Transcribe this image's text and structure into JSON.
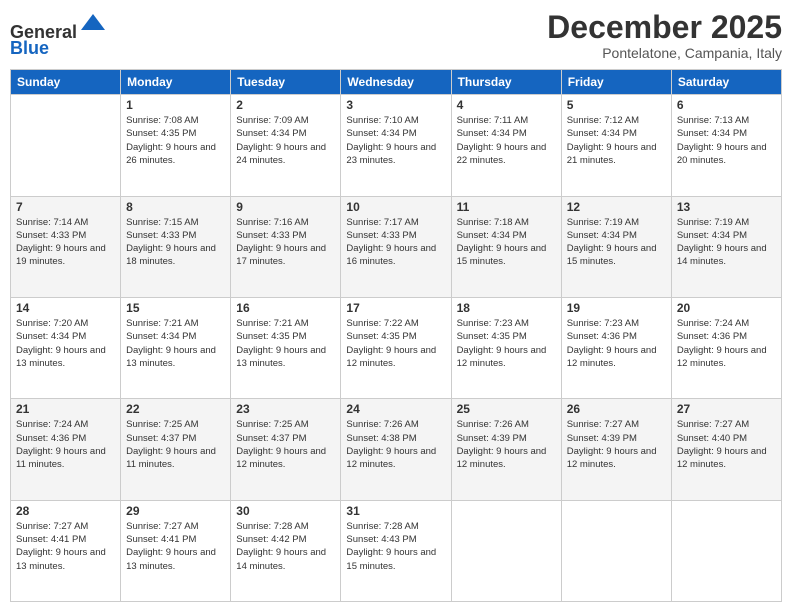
{
  "logo": {
    "general": "General",
    "blue": "Blue"
  },
  "title": "December 2025",
  "location": "Pontelatone, Campania, Italy",
  "header_days": [
    "Sunday",
    "Monday",
    "Tuesday",
    "Wednesday",
    "Thursday",
    "Friday",
    "Saturday"
  ],
  "weeks": [
    [
      null,
      {
        "day": 1,
        "sunrise": "Sunrise: 7:08 AM",
        "sunset": "Sunset: 4:35 PM",
        "daylight": "Daylight: 9 hours and 26 minutes."
      },
      {
        "day": 2,
        "sunrise": "Sunrise: 7:09 AM",
        "sunset": "Sunset: 4:34 PM",
        "daylight": "Daylight: 9 hours and 24 minutes."
      },
      {
        "day": 3,
        "sunrise": "Sunrise: 7:10 AM",
        "sunset": "Sunset: 4:34 PM",
        "daylight": "Daylight: 9 hours and 23 minutes."
      },
      {
        "day": 4,
        "sunrise": "Sunrise: 7:11 AM",
        "sunset": "Sunset: 4:34 PM",
        "daylight": "Daylight: 9 hours and 22 minutes."
      },
      {
        "day": 5,
        "sunrise": "Sunrise: 7:12 AM",
        "sunset": "Sunset: 4:34 PM",
        "daylight": "Daylight: 9 hours and 21 minutes."
      },
      {
        "day": 6,
        "sunrise": "Sunrise: 7:13 AM",
        "sunset": "Sunset: 4:34 PM",
        "daylight": "Daylight: 9 hours and 20 minutes."
      }
    ],
    [
      {
        "day": 7,
        "sunrise": "Sunrise: 7:14 AM",
        "sunset": "Sunset: 4:33 PM",
        "daylight": "Daylight: 9 hours and 19 minutes."
      },
      {
        "day": 8,
        "sunrise": "Sunrise: 7:15 AM",
        "sunset": "Sunset: 4:33 PM",
        "daylight": "Daylight: 9 hours and 18 minutes."
      },
      {
        "day": 9,
        "sunrise": "Sunrise: 7:16 AM",
        "sunset": "Sunset: 4:33 PM",
        "daylight": "Daylight: 9 hours and 17 minutes."
      },
      {
        "day": 10,
        "sunrise": "Sunrise: 7:17 AM",
        "sunset": "Sunset: 4:33 PM",
        "daylight": "Daylight: 9 hours and 16 minutes."
      },
      {
        "day": 11,
        "sunrise": "Sunrise: 7:18 AM",
        "sunset": "Sunset: 4:34 PM",
        "daylight": "Daylight: 9 hours and 15 minutes."
      },
      {
        "day": 12,
        "sunrise": "Sunrise: 7:19 AM",
        "sunset": "Sunset: 4:34 PM",
        "daylight": "Daylight: 9 hours and 15 minutes."
      },
      {
        "day": 13,
        "sunrise": "Sunrise: 7:19 AM",
        "sunset": "Sunset: 4:34 PM",
        "daylight": "Daylight: 9 hours and 14 minutes."
      }
    ],
    [
      {
        "day": 14,
        "sunrise": "Sunrise: 7:20 AM",
        "sunset": "Sunset: 4:34 PM",
        "daylight": "Daylight: 9 hours and 13 minutes."
      },
      {
        "day": 15,
        "sunrise": "Sunrise: 7:21 AM",
        "sunset": "Sunset: 4:34 PM",
        "daylight": "Daylight: 9 hours and 13 minutes."
      },
      {
        "day": 16,
        "sunrise": "Sunrise: 7:21 AM",
        "sunset": "Sunset: 4:35 PM",
        "daylight": "Daylight: 9 hours and 13 minutes."
      },
      {
        "day": 17,
        "sunrise": "Sunrise: 7:22 AM",
        "sunset": "Sunset: 4:35 PM",
        "daylight": "Daylight: 9 hours and 12 minutes."
      },
      {
        "day": 18,
        "sunrise": "Sunrise: 7:23 AM",
        "sunset": "Sunset: 4:35 PM",
        "daylight": "Daylight: 9 hours and 12 minutes."
      },
      {
        "day": 19,
        "sunrise": "Sunrise: 7:23 AM",
        "sunset": "Sunset: 4:36 PM",
        "daylight": "Daylight: 9 hours and 12 minutes."
      },
      {
        "day": 20,
        "sunrise": "Sunrise: 7:24 AM",
        "sunset": "Sunset: 4:36 PM",
        "daylight": "Daylight: 9 hours and 12 minutes."
      }
    ],
    [
      {
        "day": 21,
        "sunrise": "Sunrise: 7:24 AM",
        "sunset": "Sunset: 4:36 PM",
        "daylight": "Daylight: 9 hours and 11 minutes."
      },
      {
        "day": 22,
        "sunrise": "Sunrise: 7:25 AM",
        "sunset": "Sunset: 4:37 PM",
        "daylight": "Daylight: 9 hours and 11 minutes."
      },
      {
        "day": 23,
        "sunrise": "Sunrise: 7:25 AM",
        "sunset": "Sunset: 4:37 PM",
        "daylight": "Daylight: 9 hours and 12 minutes."
      },
      {
        "day": 24,
        "sunrise": "Sunrise: 7:26 AM",
        "sunset": "Sunset: 4:38 PM",
        "daylight": "Daylight: 9 hours and 12 minutes."
      },
      {
        "day": 25,
        "sunrise": "Sunrise: 7:26 AM",
        "sunset": "Sunset: 4:39 PM",
        "daylight": "Daylight: 9 hours and 12 minutes."
      },
      {
        "day": 26,
        "sunrise": "Sunrise: 7:27 AM",
        "sunset": "Sunset: 4:39 PM",
        "daylight": "Daylight: 9 hours and 12 minutes."
      },
      {
        "day": 27,
        "sunrise": "Sunrise: 7:27 AM",
        "sunset": "Sunset: 4:40 PM",
        "daylight": "Daylight: 9 hours and 12 minutes."
      }
    ],
    [
      {
        "day": 28,
        "sunrise": "Sunrise: 7:27 AM",
        "sunset": "Sunset: 4:41 PM",
        "daylight": "Daylight: 9 hours and 13 minutes."
      },
      {
        "day": 29,
        "sunrise": "Sunrise: 7:27 AM",
        "sunset": "Sunset: 4:41 PM",
        "daylight": "Daylight: 9 hours and 13 minutes."
      },
      {
        "day": 30,
        "sunrise": "Sunrise: 7:28 AM",
        "sunset": "Sunset: 4:42 PM",
        "daylight": "Daylight: 9 hours and 14 minutes."
      },
      {
        "day": 31,
        "sunrise": "Sunrise: 7:28 AM",
        "sunset": "Sunset: 4:43 PM",
        "daylight": "Daylight: 9 hours and 15 minutes."
      },
      null,
      null,
      null
    ]
  ]
}
